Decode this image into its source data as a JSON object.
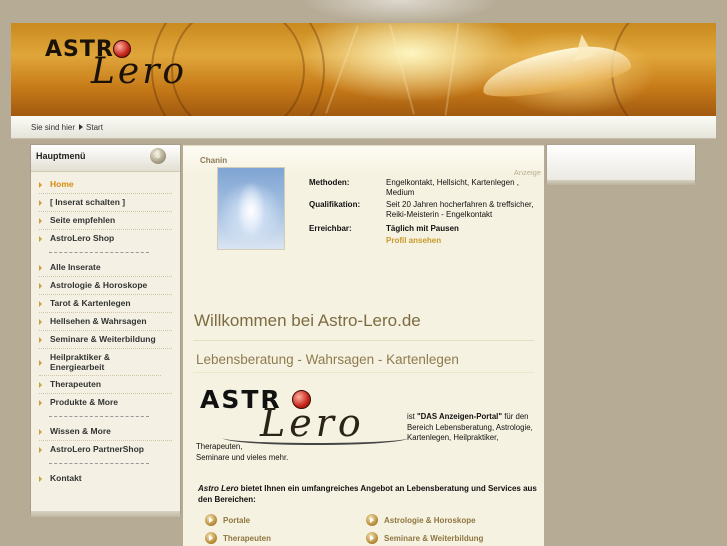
{
  "banner": {
    "logo_top": "ASTR",
    "logo_bottom": "Lero"
  },
  "breadcrumb": {
    "prefix": "Sie sind hier",
    "current": "Start"
  },
  "menu": {
    "title": "Hauptmenü",
    "group1": [
      {
        "label": "Home",
        "active": true
      },
      {
        "label": "[ Inserat schalten ]"
      },
      {
        "label": "Seite empfehlen"
      },
      {
        "label": "AstroLero Shop"
      }
    ],
    "group2": [
      {
        "label": "Alle Inserate"
      },
      {
        "label": "Astrologie & Horoskope"
      },
      {
        "label": "Tarot & Kartenlegen"
      },
      {
        "label": "Hellsehen & Wahrsagen"
      },
      {
        "label": "Seminare & Weiterbildung"
      },
      {
        "label": "Heilpraktiker & Energiearbeit",
        "line1": "Heilpraktiker &",
        "line2": "Energiearbeit"
      },
      {
        "label": "Therapeuten"
      },
      {
        "label": "Produkte & More"
      }
    ],
    "group3": [
      {
        "label": "Wissen & More"
      },
      {
        "label": "AstroLero PartnerShop"
      }
    ],
    "group4": [
      {
        "label": "Kontakt"
      }
    ]
  },
  "listing": {
    "name": "Chanin",
    "ad_label": "Anzeige",
    "methoden_label": "Methoden:",
    "methoden_value": "Engelkontakt, Hellsicht, Kartenlegen , Medium",
    "qualifikation_label": "Qualifikation:",
    "qualifikation_value": "Seit 20 Jahren hocherfahren & treffsicher, Reiki-Meisterin - Engelkontakt",
    "erreichbar_label": "Erreichbar:",
    "erreichbar_value": "Täglich mit Pausen",
    "profil_link": "Profil ansehen"
  },
  "content": {
    "welcome": "Willkommen bei Astro-Lero.de",
    "subheading": "Lebensberatung - Wahrsagen - Kartenlegen",
    "logo_top": "ASTR",
    "logo_bottom": "Lero",
    "intro_prefix": "ist ",
    "intro_bold": "\"DAS Anzeigen-Portal\"",
    "intro_rest": " für den Bereich Lebensberatung, Astrologie, Kartenlegen, Heilpraktiker,",
    "intro_line_a": "Therapeuten,",
    "intro_line_b": "Seminare und vieles mehr.",
    "lead_italic": "Astro Lero",
    "lead_rest": " bietet Ihnen ein umfangreiches Angebot an Lebensberatung und Services aus den Bereichen:"
  },
  "categories": {
    "col1": [
      "Portale",
      "Therapeuten"
    ],
    "col2": [
      "Astrologie & Horoskope",
      "Seminare & Weiterbildung"
    ]
  }
}
